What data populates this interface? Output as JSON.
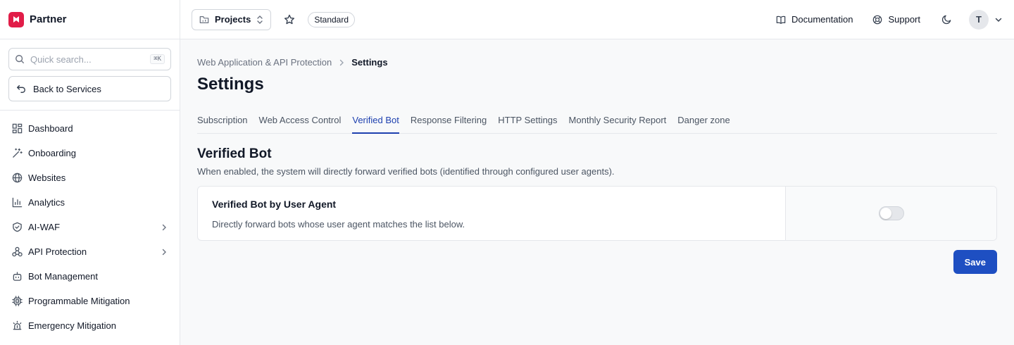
{
  "brand": {
    "name": "Partner",
    "color": "#e11d48"
  },
  "sidebar": {
    "search": {
      "placeholder": "Quick search...",
      "shortcut": "⌘K"
    },
    "back_label": "Back to Services",
    "items": [
      {
        "label": "Dashboard",
        "icon": "dashboard-icon"
      },
      {
        "label": "Onboarding",
        "icon": "wand-icon"
      },
      {
        "label": "Websites",
        "icon": "globe-icon"
      },
      {
        "label": "Analytics",
        "icon": "bar-chart-icon"
      },
      {
        "label": "AI-WAF",
        "icon": "shield-icon"
      },
      {
        "label": "API Protection",
        "icon": "webhook-icon"
      },
      {
        "label": "Bot Management",
        "icon": "bot-icon"
      },
      {
        "label": "Programmable Mitigation",
        "icon": "chip-icon"
      },
      {
        "label": "Emergency Mitigation",
        "icon": "siren-icon"
      }
    ]
  },
  "header": {
    "project_label": "Projects",
    "plan_badge": "Standard",
    "documentation_label": "Documentation",
    "support_label": "Support",
    "avatar_initial": "T"
  },
  "breadcrumb": {
    "parent": "Web Application & API Protection",
    "current": "Settings"
  },
  "page_title": "Settings",
  "tabs": [
    {
      "label": "Subscription",
      "active": false
    },
    {
      "label": "Web Access Control",
      "active": false
    },
    {
      "label": "Verified Bot",
      "active": true
    },
    {
      "label": "Response Filtering",
      "active": false
    },
    {
      "label": "HTTP Settings",
      "active": false
    },
    {
      "label": "Monthly Security Report",
      "active": false
    },
    {
      "label": "Danger zone",
      "active": false
    }
  ],
  "section": {
    "title": "Verified Bot",
    "description": "When enabled, the system will directly forward verified bots (identified through configured user agents).",
    "setting": {
      "title": "Verified Bot by User Agent",
      "description": "Directly forward bots whose user agent matches the list below.",
      "enabled": false
    }
  },
  "save_label": "Save",
  "colors": {
    "accent": "#1e40af",
    "primary_button": "#1e4fc2"
  }
}
